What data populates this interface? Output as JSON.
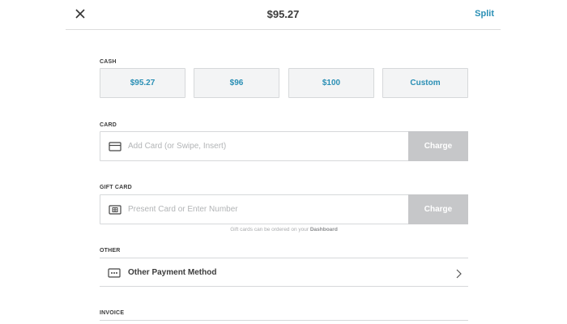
{
  "header": {
    "title": "$95.27",
    "split_label": "Split"
  },
  "cash": {
    "label": "CASH",
    "options": [
      "$95.27",
      "$96",
      "$100",
      "Custom"
    ]
  },
  "card": {
    "label": "CARD",
    "placeholder": "Add Card (or Swipe, Insert)",
    "charge_label": "Charge"
  },
  "gift_card": {
    "label": "GIFT CARD",
    "placeholder": "Present Card or Enter Number",
    "charge_label": "Charge",
    "note_prefix": "Gift cards can be ordered on your ",
    "note_link": "Dashboard"
  },
  "other": {
    "label": "OTHER",
    "item_label": "Other Payment Method"
  },
  "invoice": {
    "label": "INVOICE"
  },
  "colors": {
    "accent": "#2a8fb5",
    "disabled_button": "#c6c7c9",
    "cash_button_bg": "#f3f4f5"
  }
}
